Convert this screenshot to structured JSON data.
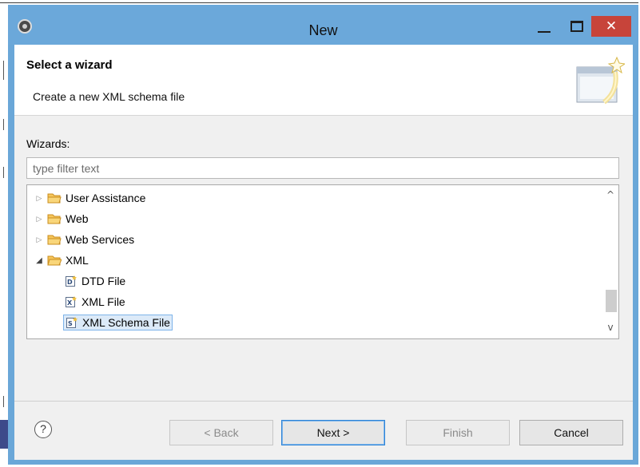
{
  "window": {
    "title": "New",
    "close_glyph": "✕",
    "titlebar_color": "#6ba8da",
    "close_color": "#c7443a"
  },
  "header": {
    "title": "Select a wizard",
    "description": "Create a new XML schema file"
  },
  "wizards": {
    "label": "Wizards:",
    "filter_placeholder": "type filter text",
    "filter_value": ""
  },
  "tree": {
    "items": [
      {
        "label": "User Assistance",
        "type": "folder",
        "expanded": false,
        "level": 0
      },
      {
        "label": "Web",
        "type": "folder",
        "expanded": false,
        "level": 0
      },
      {
        "label": "Web Services",
        "type": "folder",
        "expanded": false,
        "level": 0
      },
      {
        "label": "XML",
        "type": "folder",
        "expanded": true,
        "level": 0
      },
      {
        "label": "DTD File",
        "type": "file",
        "icon": "dtd-file-icon",
        "level": 1
      },
      {
        "label": "XML File",
        "type": "file",
        "icon": "xml-file-icon",
        "level": 1
      },
      {
        "label": "XML Schema File",
        "type": "file",
        "icon": "xsd-file-icon",
        "level": 1,
        "selected": true
      }
    ],
    "scroll_up_glyph": "^",
    "scroll_down_glyph": "v"
  },
  "footer": {
    "help_glyph": "?",
    "back_label": "< Back",
    "next_label": "Next >",
    "finish_label": "Finish",
    "cancel_label": "Cancel"
  },
  "colors": {
    "selection_bg": "#dceaf8",
    "selection_border": "#7eb4ea",
    "folder": "#e8a93a",
    "default_button_border": "#2f84d6"
  }
}
